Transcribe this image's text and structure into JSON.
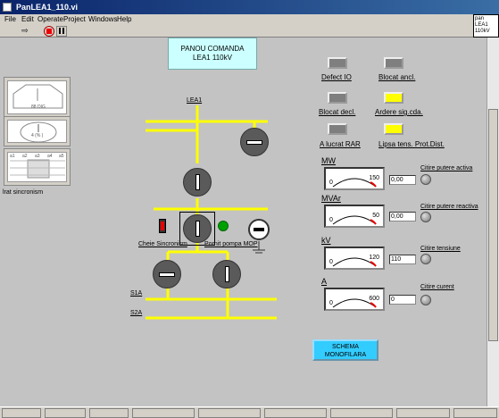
{
  "window": {
    "title": "PanLEA1_110.vi"
  },
  "menu": [
    "File",
    "Edit",
    "Operate",
    "Project",
    "Windows",
    "Help"
  ],
  "vi_icon": {
    "lines": [
      "pan",
      "LEA1",
      "110kV"
    ]
  },
  "header": {
    "line1": "PANOU COMANDA",
    "line2": "LEA1 110kV"
  },
  "left": {
    "sync_label": "lrat sincronism",
    "grid_labels": [
      "a1",
      "a2",
      "a3",
      "a4",
      "a5"
    ]
  },
  "diagram": {
    "lea_label": "LEA1",
    "cheie_label": "Cheie Sincronism",
    "pompa_label": "Pornit pompa MOP",
    "bus1_label": "S1A",
    "bus2_label": "S2A"
  },
  "indicators": [
    {
      "label": "Defect IO",
      "color": "#7f7f7f"
    },
    {
      "label": "Blocat ancl.",
      "color": "#7f7f7f"
    },
    {
      "label": "Blocat decl.",
      "color": "#7f7f7f"
    },
    {
      "label": "Ardere sig.cda.",
      "color": "#ffff00"
    },
    {
      "label": "A lucrat RAR",
      "color": "#7f7f7f"
    },
    {
      "label": "Lipsa tens. Prot.Dist.",
      "color": "#ffff00"
    }
  ],
  "meters": [
    {
      "title": "MW",
      "min": "0",
      "max": "150",
      "value": "0,00",
      "read_label": "Citire putere activa"
    },
    {
      "title": "MVAr",
      "min": "0",
      "max": "50",
      "value": "0,00",
      "read_label": "Citire putere reactiva"
    },
    {
      "title": "kV",
      "min": "0",
      "max": "120",
      "value": "110",
      "read_label": "Citire tensiune"
    },
    {
      "title": "A",
      "min": "0",
      "max": "600",
      "value": "0",
      "read_label": "Citire curent"
    }
  ],
  "schema_button": {
    "line1": "SCHEMA",
    "line2": "MONOFILARA"
  },
  "colors": {
    "accent": "#33ccff",
    "bus": "#ffff00",
    "header_bg": "#ccffff",
    "pompa_led": "#00a000"
  }
}
